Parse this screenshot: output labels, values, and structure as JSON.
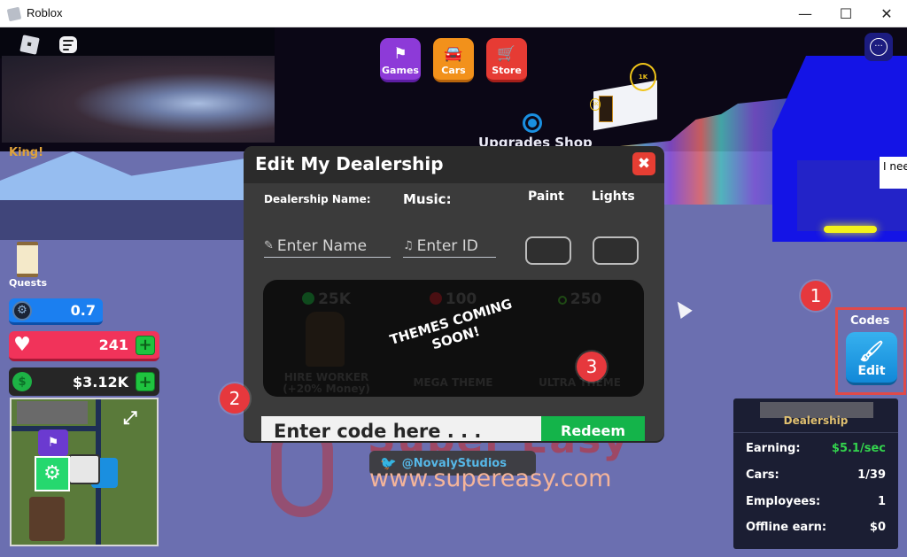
{
  "window": {
    "title": "Roblox",
    "controls": {
      "minimize": "—",
      "maximize": "☐",
      "close": "✕"
    }
  },
  "top_bar": {
    "buttons": [
      {
        "label": "Games",
        "icon": "checkered-flag-icon",
        "glyph": "⚑",
        "color": "#8d3ad8"
      },
      {
        "label": "Cars",
        "icon": "car-icon",
        "glyph": "🚘",
        "color": "#f2911b"
      },
      {
        "label": "Store",
        "icon": "shopping-cart-icon",
        "glyph": "🛒",
        "color": "#e63b34"
      }
    ],
    "menu_glyph": "···"
  },
  "world": {
    "player_tag": "King!",
    "upgrades_shop_label": "Upgrades Shop",
    "coin_label": "1K",
    "small_coin_label": "1K",
    "speech_text": "I nee"
  },
  "hud": {
    "quests_label": "Quests",
    "speed_value": "0.7",
    "health_value": "241",
    "cash_value": "$3.12K",
    "plus_glyph": "+",
    "heart_glyph": "♥",
    "dollar_glyph": "$",
    "tire_glyph": "⚙",
    "minimap_expand_glyph": "⤢"
  },
  "codes": {
    "label": "Codes",
    "edit_label": "Edit",
    "edit_glyph": "🖌"
  },
  "annotations": {
    "step1": "1",
    "step2": "2",
    "step3": "3"
  },
  "dealership_panel": {
    "title": "Dealership",
    "rows": [
      {
        "label": "Earning:",
        "value": "$5.1/sec"
      },
      {
        "label": "Cars:",
        "value": "1/39"
      },
      {
        "label": "Employees:",
        "value": "1"
      },
      {
        "label": "Offline earn:",
        "value": "$0"
      }
    ],
    "earning_color": "#33d44d"
  },
  "modal": {
    "title": "Edit My Dealership",
    "close_glyph": "✖",
    "dealership_name_label": "Dealership Name:",
    "dealership_name_placeholder": "Enter Name",
    "music_label": "Music:",
    "music_placeholder": "Enter ID",
    "paint_label": "Paint",
    "lights_label": "Lights",
    "pencil_glyph": "✎",
    "note_glyph": "♫",
    "themes": [
      {
        "price": "25K",
        "name_line1": "HIRE WORKER",
        "name_line2": "(+20% Money)"
      },
      {
        "price": "100",
        "name_line1": "MEGA THEME",
        "name_line2": ""
      },
      {
        "price": "250",
        "name_line1": "ULTRA THEME",
        "name_line2": ""
      }
    ],
    "themes_overlay_line1": "THEMES COMING",
    "themes_overlay_line2": "SOON!",
    "code_placeholder": "Enter code here . . .",
    "redeem_label": "Redeem"
  },
  "social": {
    "twitter_handle": "@NovalyStudios",
    "twitter_glyph": "🐦"
  },
  "watermark": {
    "brand": "Super Easy",
    "url": "www.supereasy.com"
  }
}
